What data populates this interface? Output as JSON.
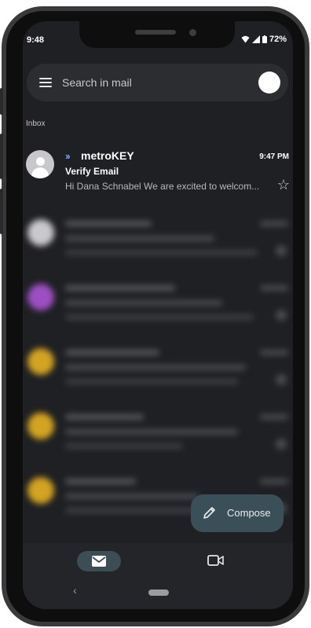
{
  "status_bar": {
    "time": "9:48",
    "battery": "72%"
  },
  "search": {
    "placeholder": "Search in mail"
  },
  "inbox": {
    "label": "Inbox"
  },
  "first_email": {
    "sender": "metroKEY",
    "time": "9:47 PM",
    "subject": "Verify Email",
    "preview": "Hi Dana Schnabel We are excited to welcom..."
  },
  "compose": {
    "label": "Compose"
  },
  "icons": {
    "menu": "hamburger-menu-icon",
    "star": "star-outline-icon",
    "compose": "pencil-icon",
    "mail": "mail-icon",
    "meet": "video-camera-icon",
    "back": "back-chevron-icon"
  },
  "colors": {
    "background": "#1f2023",
    "accent_chevron": "#6ea0ff",
    "compose_bg": "#3b4f58",
    "nav_active": "#3d4d55"
  },
  "blurred_rows": [
    {
      "avatar_color": "#c9c9cc"
    },
    {
      "avatar_color": "#9d4fc2"
    },
    {
      "avatar_color": "#d3a322"
    },
    {
      "avatar_color": "#d3a322"
    },
    {
      "avatar_color": "#d3a322"
    }
  ]
}
